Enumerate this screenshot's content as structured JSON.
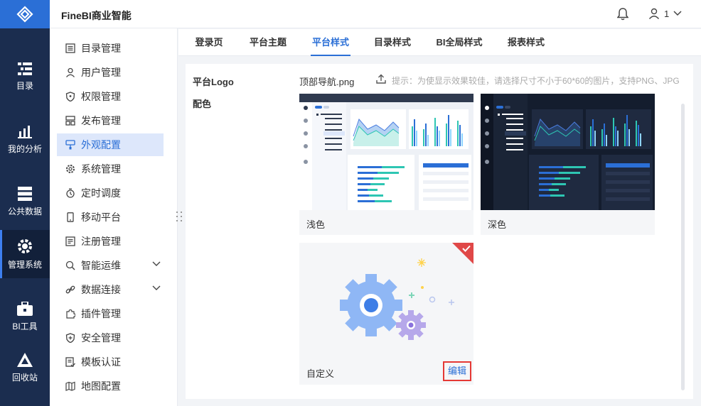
{
  "app": {
    "title": "FineBI商业智能"
  },
  "header": {
    "user_label": "1"
  },
  "rail": [
    {
      "label": "目录",
      "icon": "catalog-icon"
    },
    {
      "label": "我的分析",
      "icon": "analysis-icon"
    },
    {
      "label": "公共数据",
      "icon": "database-icon"
    },
    {
      "label": "管理系统",
      "icon": "gear-icon",
      "active": true
    },
    {
      "label": "BI工具",
      "icon": "toolbox-icon"
    },
    {
      "label": "回收站",
      "icon": "recycle-icon"
    }
  ],
  "sidebar": {
    "items": [
      {
        "label": "目录管理"
      },
      {
        "label": "用户管理"
      },
      {
        "label": "权限管理"
      },
      {
        "label": "发布管理"
      },
      {
        "label": "外观配置",
        "active": true
      },
      {
        "label": "系统管理"
      },
      {
        "label": "定时调度"
      },
      {
        "label": "移动平台"
      },
      {
        "label": "注册管理"
      },
      {
        "label": "智能运维",
        "expandable": true
      },
      {
        "label": "数据连接",
        "expandable": true
      },
      {
        "label": "插件管理"
      },
      {
        "label": "安全管理"
      },
      {
        "label": "模板认证"
      },
      {
        "label": "地图配置"
      }
    ]
  },
  "tabs": [
    {
      "label": "登录页"
    },
    {
      "label": "平台主题"
    },
    {
      "label": "平台样式",
      "active": true
    },
    {
      "label": "目录样式"
    },
    {
      "label": "BI全局样式"
    },
    {
      "label": "报表样式"
    }
  ],
  "content": {
    "logo_label": "平台Logo",
    "color_label": "配色",
    "file_name": "顶部导航.png",
    "hint": "提示：为使显示效果较佳，请选择尺寸不小于60*60的图片，支持PNG、JPG",
    "themes": {
      "light": "浅色",
      "dark": "深色",
      "custom": "自定义",
      "edit": "编辑"
    }
  },
  "colors": {
    "primary": "#2b6fd6",
    "rail_bg": "#1b2d4f",
    "dark_theme": "#1c2639",
    "selected_badge": "#e04848"
  }
}
